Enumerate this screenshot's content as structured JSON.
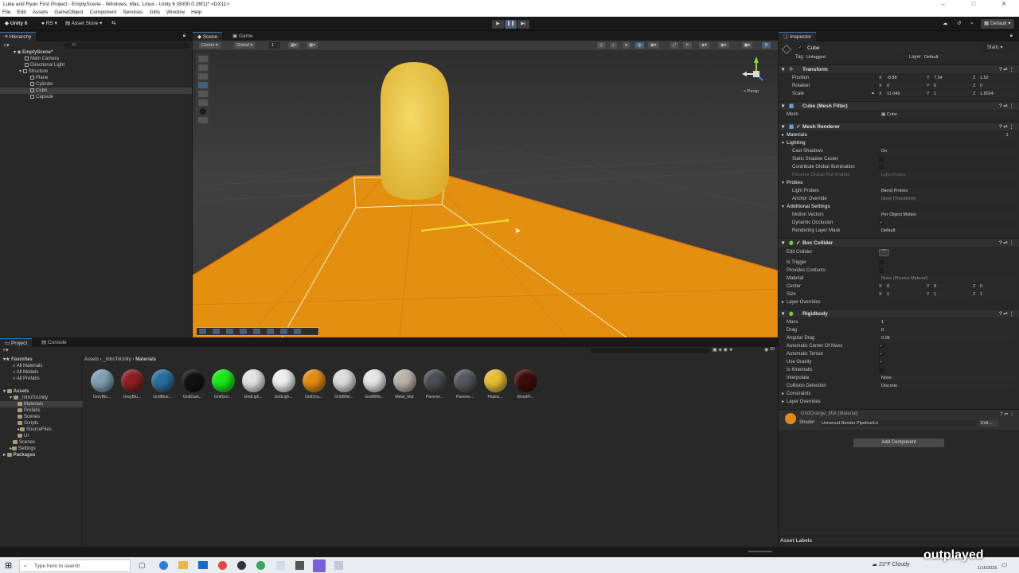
{
  "window": {
    "title": "Luke and Ryan First Project - EmptyScene - Windows, Mac, Linux - Unity 6 (6000.0.26f1)* <DX11>",
    "controls": [
      "–",
      "□",
      "✕"
    ]
  },
  "menu": [
    "File",
    "Edit",
    "Assets",
    "GameObject",
    "Component",
    "Services",
    "Jobs",
    "Window",
    "Help"
  ],
  "toolbar": {
    "unity": "Unity 6",
    "account": "RS",
    "asset_store": "Asset Store",
    "layout": "Default"
  },
  "hierarchy": {
    "tab": "Hierarchy",
    "search_placeholder": "All",
    "items": [
      {
        "label": "EmptyScene*"
      },
      {
        "label": "Main Camera"
      },
      {
        "label": "Directional Light"
      },
      {
        "label": "Structure"
      },
      {
        "label": "Plane"
      },
      {
        "label": "Cylinder"
      },
      {
        "label": "Cube"
      },
      {
        "label": "Capsule"
      }
    ]
  },
  "scene": {
    "tabs": [
      "Scene",
      "Game"
    ],
    "pivot": "Center",
    "space": "Global",
    "grid_snap": "1",
    "persp": "< Persp"
  },
  "project": {
    "tabs": [
      "Project",
      "Console"
    ],
    "favorites": "Favorites",
    "fav_items": [
      "All Materials",
      "All Models",
      "All Prefabs"
    ],
    "assets_root": "Assets",
    "tree": [
      "_IntroToUnity",
      "Materials",
      "Prefabs",
      "Scenes",
      "Scripts",
      "SourceFiles",
      "UI",
      "Scenes",
      "Settings"
    ],
    "packages": "Packages",
    "breadcrumb": [
      "Assets",
      "_IntroToUnity",
      "Materials"
    ],
    "item_count": "30",
    "materials": [
      {
        "label": "GreyBlu...",
        "color": "#7fa0b4"
      },
      {
        "label": "GreyBlu...",
        "color": "#8c1f25"
      },
      {
        "label": "GridBlue...",
        "color": "#2a6f9c"
      },
      {
        "label": "GridDark...",
        "color": "#121212"
      },
      {
        "label": "GridGre...",
        "color": "#19e818"
      },
      {
        "label": "GridLigh...",
        "color": "#e3e3e3"
      },
      {
        "label": "GridLigh...",
        "color": "#efefef"
      },
      {
        "label": "GridOra...",
        "color": "#e38a12"
      },
      {
        "label": "GridWhit...",
        "color": "#dcdcdc"
      },
      {
        "label": "GridWhit...",
        "color": "#e6e6e6"
      },
      {
        "label": "Metal_Mat",
        "color": "#b9b3aa"
      },
      {
        "label": "Paveme...",
        "color": "#4b4f55"
      },
      {
        "label": "Paveme...",
        "color": "#55595f"
      },
      {
        "label": "Plastic...",
        "color": "#e8bd35"
      },
      {
        "label": "WoodFl...",
        "color": "#3f0c0c"
      }
    ]
  },
  "inspector": {
    "tab": "Inspector",
    "object_name": "Cube",
    "static": "Static",
    "tag_label": "Tag",
    "tag": "Untagged",
    "layer_label": "Layer",
    "layer": "Default",
    "transform": {
      "title": "Transform",
      "position_label": "Position",
      "px": "-8.88",
      "py": "7.34",
      "pz": "1.52",
      "rotation_label": "Rotation",
      "rx": "0",
      "ry": "0",
      "rz": "0",
      "scale_label": "Scale",
      "sx": "11.049",
      "sy": "1",
      "sz": "1.8024"
    },
    "mesh_filter": {
      "title": "Cube (Mesh Filter)",
      "mesh_label": "Mesh",
      "mesh": "Cube"
    },
    "mesh_renderer": {
      "title": "Mesh Renderer",
      "materials": "Materials",
      "materials_count": "1",
      "lighting": "Lighting",
      "cast_shadows": "Cast Shadows",
      "cast_shadows_val": "On",
      "static_shadow": "Static Shadow Caster",
      "contribute_gi": "Contribute Global Illumination",
      "receive_gi": "Receive Global Illumination",
      "receive_gi_val": "Light Probes",
      "probes": "Probes",
      "light_probes": "Light Probes",
      "light_probes_val": "Blend Probes",
      "anchor_override": "Anchor Override",
      "anchor_override_val": "None (Transform)",
      "additional": "Additional Settings",
      "motion_vectors": "Motion Vectors",
      "motion_vectors_val": "Per Object Motion",
      "dynamic_occlusion": "Dynamic Occlusion",
      "rendering_layer": "Rendering Layer Mask",
      "rendering_layer_val": "Default"
    },
    "box_collider": {
      "title": "Box Collider",
      "edit": "Edit Collider",
      "is_trigger": "Is Trigger",
      "provides_contacts": "Provides Contacts",
      "material": "Material",
      "material_val": "None (Physics Material)",
      "center": "Center",
      "cx": "0",
      "cy": "0",
      "cz": "0",
      "size": "Size",
      "sx": "1",
      "sy": "1",
      "sz": "1",
      "layer_overrides": "Layer Overrides"
    },
    "rigidbody": {
      "title": "Rigidbody",
      "mass": "Mass",
      "mass_val": "1",
      "drag": "Drag",
      "drag_val": "0",
      "angular_drag": "Angular Drag",
      "angular_drag_val": "0.05",
      "auto_com": "Automatic Center Of Mass",
      "auto_tensor": "Automatic Tensor",
      "use_gravity": "Use Gravity",
      "is_kinematic": "Is Kinematic",
      "interpolate": "Interpolate",
      "interpolate_val": "None",
      "collision": "Collision Detection",
      "collision_val": "Discrete",
      "constraints": "Constraints",
      "layer_overrides": "Layer Overrides"
    },
    "material_block": {
      "name": "GridOrange_Mat (Material)",
      "shader_label": "Shader",
      "shader": "Universal Render Pipeline/Lit",
      "edit": "Edit..."
    },
    "add_component": "Add Component",
    "asset_labels": "Asset Labels"
  },
  "taskbar": {
    "search_placeholder": "Type here to search",
    "weather": "23°F Cloudy",
    "date": "1/16/2025",
    "watermark": "outplayed"
  },
  "colors": {
    "accent": "#3a79bb",
    "orange": "#e8920f",
    "capsule": "#f0cd4a"
  }
}
